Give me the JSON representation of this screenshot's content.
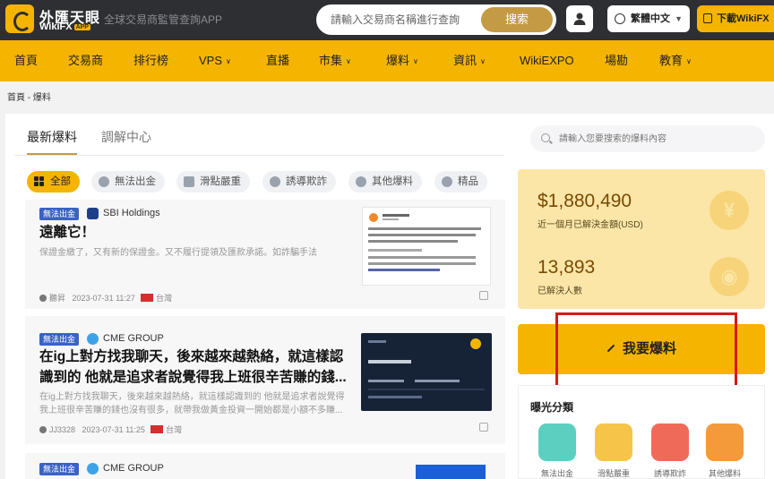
{
  "header": {
    "brand_cn": "外匯天眼",
    "brand_en": "WikiFX",
    "brand_app": "APP",
    "tagline": "全球交易商監管查詢APP",
    "search_placeholder": "請輸入交易商名稱進行查詢",
    "search_button": "搜索",
    "language": "繁體中文",
    "download": "下載WikiFX"
  },
  "nav": {
    "items": [
      {
        "label": "首頁"
      },
      {
        "label": "交易商"
      },
      {
        "label": "排行榜"
      },
      {
        "label": "VPS"
      },
      {
        "label": "直播"
      },
      {
        "label": "市集"
      },
      {
        "label": "爆料"
      },
      {
        "label": "資訊"
      },
      {
        "label": "WikiEXPO"
      },
      {
        "label": "場勘"
      },
      {
        "label": "教育"
      }
    ]
  },
  "breadcrumb": "首頁 - 爆料",
  "tabs": {
    "active": "最新爆料",
    "other": "調解中心"
  },
  "exposure_search_placeholder": "請輸入您要搜索的爆料內容",
  "filters": [
    {
      "label": "全部"
    },
    {
      "label": "無法出金"
    },
    {
      "label": "滑點嚴重"
    },
    {
      "label": "誘導欺詐"
    },
    {
      "label": "其他爆料"
    },
    {
      "label": "精品"
    }
  ],
  "posts": [
    {
      "category": "無法出金",
      "broker": "SBI Holdings",
      "title": "遠離它！",
      "summary": "保證金繳了，又有新的保證金。又不履行提領及匯款承諾。如詐騙手法",
      "user": "聽昇",
      "time": "2023-07-31 11:27",
      "region": "台灣"
    },
    {
      "category": "無法出金",
      "broker": "CME GROUP",
      "title_line1": "在ig上對方找我聊天，後來越來越熱絡，就這樣認",
      "title_line2": "識到的 他就是追求者說覺得我上班很辛苦賺的錢...",
      "summary_line1": "在ig上對方找我聊天，後來越來越熱絡，就這樣認識到的 他就是追求者說覺得",
      "summary_line2": "我上班很辛苦賺的錢也沒有很多，就帶我做黃金投資一開始都是小額不多賺...",
      "user": "JJ3328",
      "time": "2023-07-31 11:25",
      "region": "台灣"
    },
    {
      "category": "無法出金",
      "broker": "CME GROUP"
    }
  ],
  "stats": {
    "amount": "$1,880,490",
    "amount_label": "近一個月已解決金額(USD)",
    "cases": "13,893",
    "cases_label": "已解決人數"
  },
  "report_button": "我要爆料",
  "categories": {
    "title": "曝光分類",
    "items": [
      {
        "label": "無法出金",
        "color": "#5ccfc0"
      },
      {
        "label": "滑點嚴重",
        "color": "#f7c44a"
      },
      {
        "label": "誘導欺詐",
        "color": "#f06a5a"
      },
      {
        "label": "其他爆料",
        "color": "#f59a3a"
      }
    ]
  },
  "colors": {
    "header_bg": "#2e2f33",
    "brand_yellow": "#f5b400",
    "gold_button": "#c49a45",
    "category_badge": "#3a62c5",
    "highlight_red": "#d51a1a"
  }
}
